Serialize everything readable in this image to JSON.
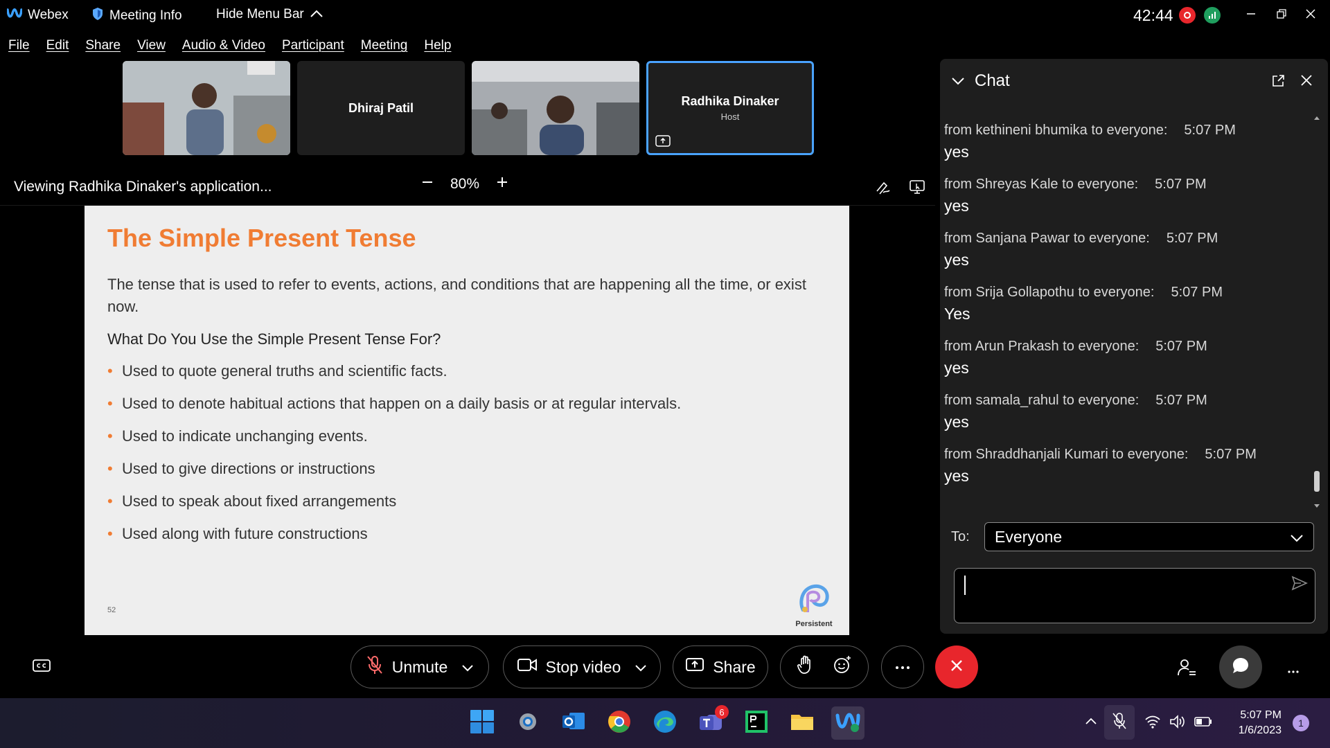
{
  "titlebar": {
    "app_name": "Webex",
    "meeting_info": "Meeting Info",
    "hide_menu": "Hide Menu Bar",
    "timer": "42:44"
  },
  "menu": [
    "File",
    "Edit",
    "Share",
    "View",
    "Audio & Video",
    "Participant",
    "Meeting",
    "Help"
  ],
  "participants": [
    {
      "name": "",
      "video": true
    },
    {
      "name": "Dhiraj Patil",
      "video": false
    },
    {
      "name": "",
      "video": true
    },
    {
      "name": "Radhika Dinaker",
      "role": "Host",
      "video": false,
      "active": true
    }
  ],
  "viewing": {
    "label": "Viewing Radhika Dinaker's application...",
    "zoom": "80%"
  },
  "slide": {
    "title": "The Simple Present Tense",
    "intro": "The tense that is used to refer to events, actions, and conditions that are happening all the time, or exist now.",
    "question": "What Do You Use the Simple Present Tense For?",
    "bullets": [
      "Used to quote general truths and scientific facts.",
      "Used to denote habitual actions that happen on a daily basis or at regular intervals.",
      "Used to indicate unchanging events.",
      "Used to give directions or instructions",
      "Used to speak about fixed arrangements",
      "Used along with future constructions"
    ],
    "page_number": "52",
    "logo_text": "Persistent"
  },
  "chat": {
    "title": "Chat",
    "messages": [
      {
        "meta": "from kethineni bhumika to everyone:",
        "time": "5:07 PM",
        "text": "yes"
      },
      {
        "meta": "from Shreyas Kale to everyone:",
        "time": "5:07 PM",
        "text": "yes"
      },
      {
        "meta": "from Sanjana Pawar to everyone:",
        "time": "5:07 PM",
        "text": "yes"
      },
      {
        "meta": "from Srija Gollapothu to everyone:",
        "time": "5:07 PM",
        "text": "Yes"
      },
      {
        "meta": "from Arun Prakash to everyone:",
        "time": "5:07 PM",
        "text": "yes"
      },
      {
        "meta": "from samala_rahul to everyone:",
        "time": "5:07 PM",
        "text": "yes"
      },
      {
        "meta": "from Shraddhanjali Kumari to everyone:",
        "time": "5:07 PM",
        "text": "yes"
      }
    ],
    "to_label": "To:",
    "to_value": "Everyone"
  },
  "controls": {
    "unmute": "Unmute",
    "stop_video": "Stop video",
    "share": "Share"
  },
  "taskbar": {
    "time": "5:07 PM",
    "date": "1/6/2023",
    "teams_badge": "6",
    "notification_count": "1"
  },
  "colors": {
    "accent_orange": "#f07c33",
    "active_border": "#4aa3ff",
    "end_red": "#e8262c"
  }
}
